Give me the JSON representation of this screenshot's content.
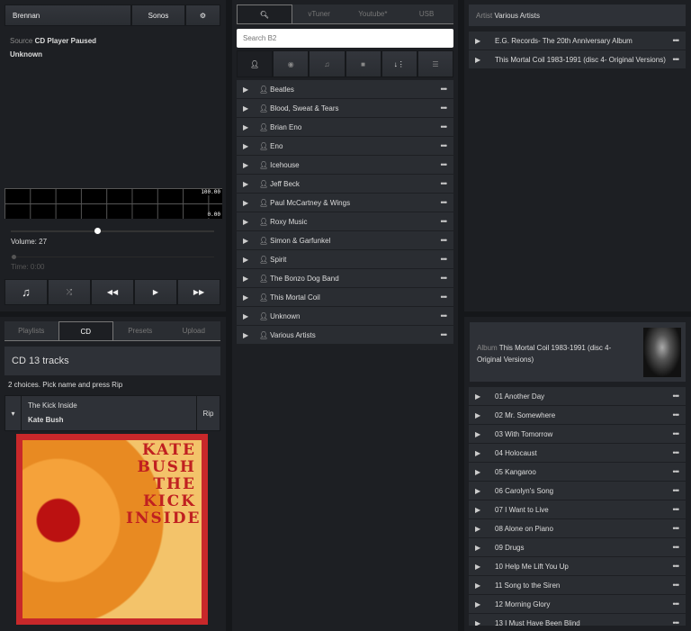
{
  "header": {
    "room": "Brennan",
    "system": "Sonos",
    "settings_icon": "gear-icon"
  },
  "now_playing": {
    "source_label": "Source",
    "source_value": "CD Player Paused",
    "title": "Unknown",
    "meter_max": "100.00",
    "meter_min": "0.00",
    "volume_label": "Volume: 27",
    "volume": 27,
    "time_label": "Time: 0:00"
  },
  "transport": [
    "music-note-icon",
    "shuffle-icon",
    "rewind-icon",
    "play-icon",
    "fast-forward-icon"
  ],
  "left_tabs": [
    {
      "label": "Playlists"
    },
    {
      "label": "CD",
      "active": true
    },
    {
      "label": "Presets"
    },
    {
      "label": "Upload"
    }
  ],
  "cd": {
    "header": "CD 13 tracks",
    "hint": "2 choices. Pick name and press Rip",
    "album": "The Kick Inside",
    "artist": "Kate Bush",
    "rip": "Rip",
    "cover_text": "KATE BUSH THE KICK INSIDE"
  },
  "source_tabs": [
    {
      "label": "search-icon",
      "active": true
    },
    {
      "label": "vTuner"
    },
    {
      "label": "Youtube*"
    },
    {
      "label": "USB"
    }
  ],
  "search": {
    "placeholder": "Search B2"
  },
  "filters": [
    "artist-icon",
    "album-icon",
    "music-note-icon",
    "video-icon",
    "sort-icon",
    "list-icon"
  ],
  "artists": [
    "Beatles",
    "Blood, Sweat & Tears",
    "Brian Eno",
    "Eno",
    "Icehouse",
    "Jeff Beck",
    "Paul McCartney & Wings",
    "Roxy Music",
    "Simon & Garfunkel",
    "Spirit",
    "The Bonzo Dog Band",
    "This Mortal Coil",
    "Unknown",
    "Various Artists"
  ],
  "artist_panel": {
    "label": "Artist",
    "name": "Various Artists",
    "albums": [
      "E.G. Records- The 20th Anniversary Album",
      "This Mortal Coil 1983-1991 (disc 4- Original Versions)"
    ]
  },
  "album_panel": {
    "label": "Album",
    "name": "This Mortal Coil 1983-1991 (disc 4- Original Versions)",
    "tracks": [
      "01 Another Day",
      "02 Mr. Somewhere",
      "03 With Tomorrow",
      "04 Holocaust",
      "05 Kangaroo",
      "06 Carolyn's Song",
      "07 I Want to Live",
      "08 Alone on Piano",
      "09 Drugs",
      "10 Help Me Lift You Up",
      "11 Song to the Siren",
      "12 Morning Glory",
      "13 I Must Have Been Blind"
    ]
  }
}
